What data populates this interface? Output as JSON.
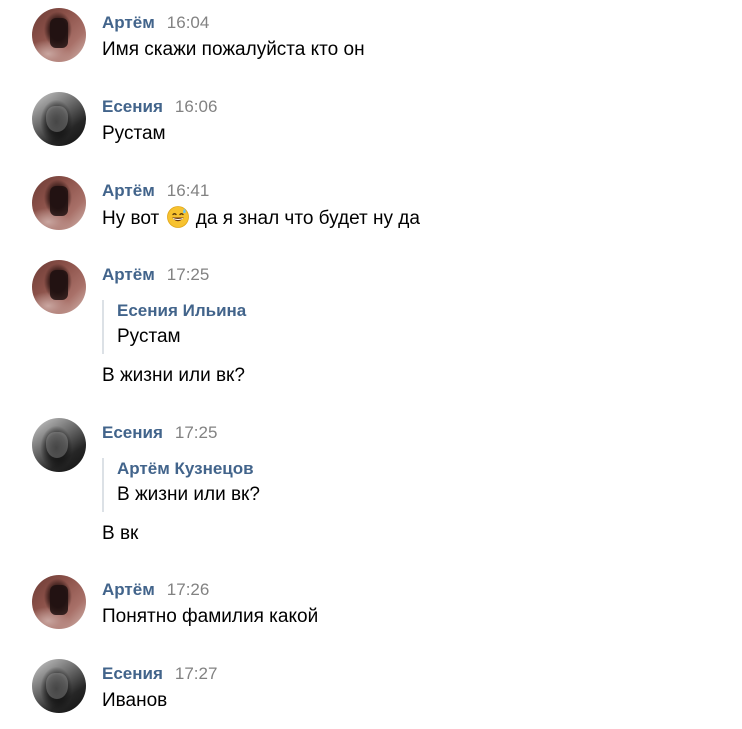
{
  "messages": [
    {
      "author": "Артём",
      "time": "16:04",
      "text": "Имя скажи пожалуйста кто он"
    },
    {
      "author": "Есения",
      "time": "16:06",
      "text": "Рустам"
    },
    {
      "author": "Артём",
      "time": "16:41",
      "text_before": "Ну вот",
      "emoji": "grinning-sweat-emoji",
      "text_after": "да я знал что будет ну да"
    },
    {
      "author": "Артём",
      "time": "17:25",
      "quote": {
        "author": "Есения Ильина",
        "text": "Рустам"
      },
      "text": "В жизни или вк?"
    },
    {
      "author": "Есения",
      "time": "17:25",
      "quote": {
        "author": "Артём Кузнецов",
        "text": "В жизни или вк?"
      },
      "text": "В вк"
    },
    {
      "author": "Артём",
      "time": "17:26",
      "text": "Понятно фамилия какой"
    },
    {
      "author": "Есения",
      "time": "17:27",
      "text": "Иванов"
    }
  ],
  "colors": {
    "author": "#42648b",
    "time": "#828282",
    "quote_border": "#dce1e6",
    "text": "#000000",
    "background": "#ffffff"
  }
}
